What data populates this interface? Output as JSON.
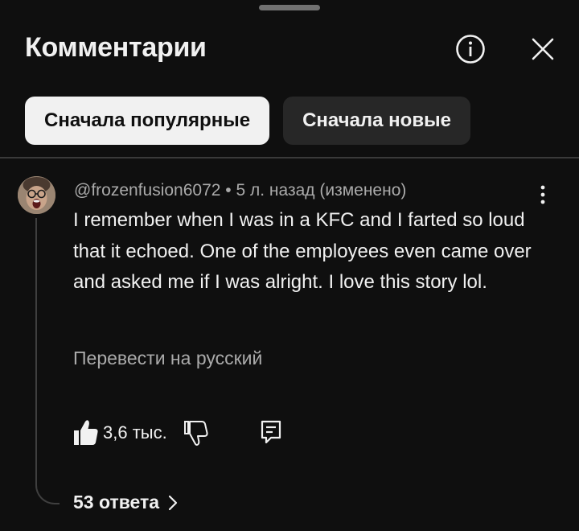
{
  "header": {
    "title": "Комментарии"
  },
  "sort_chips": [
    {
      "label": "Сначала популярные",
      "selected": true
    },
    {
      "label": "Сначала новые",
      "selected": false
    }
  ],
  "comment": {
    "author": "@frozenfusion6072",
    "separator": "•",
    "time": "5 л. назад (изменено)",
    "text": "I remember when I was in a KFC and I farted so loud that it echoed. One of the employees even came over and asked me if I was alright. I love this story lol.",
    "translate_label": "Перевести на русский",
    "like_count": "3,6 тыс.",
    "replies_label": "53 ответа"
  },
  "colors": {
    "background": "#0f0f0f",
    "text_primary": "#f1f1f1",
    "text_secondary": "#aaaaaa",
    "chip_active_bg": "#f1f1f1",
    "chip_inactive_bg": "#272727"
  },
  "icons": {
    "info": "info-circle-icon",
    "close": "close-icon",
    "more": "more-vertical-icon",
    "like": "thumbs-up-icon",
    "dislike": "thumbs-down-icon",
    "reply": "reply-comment-icon",
    "chevron": "chevron-right-icon"
  }
}
